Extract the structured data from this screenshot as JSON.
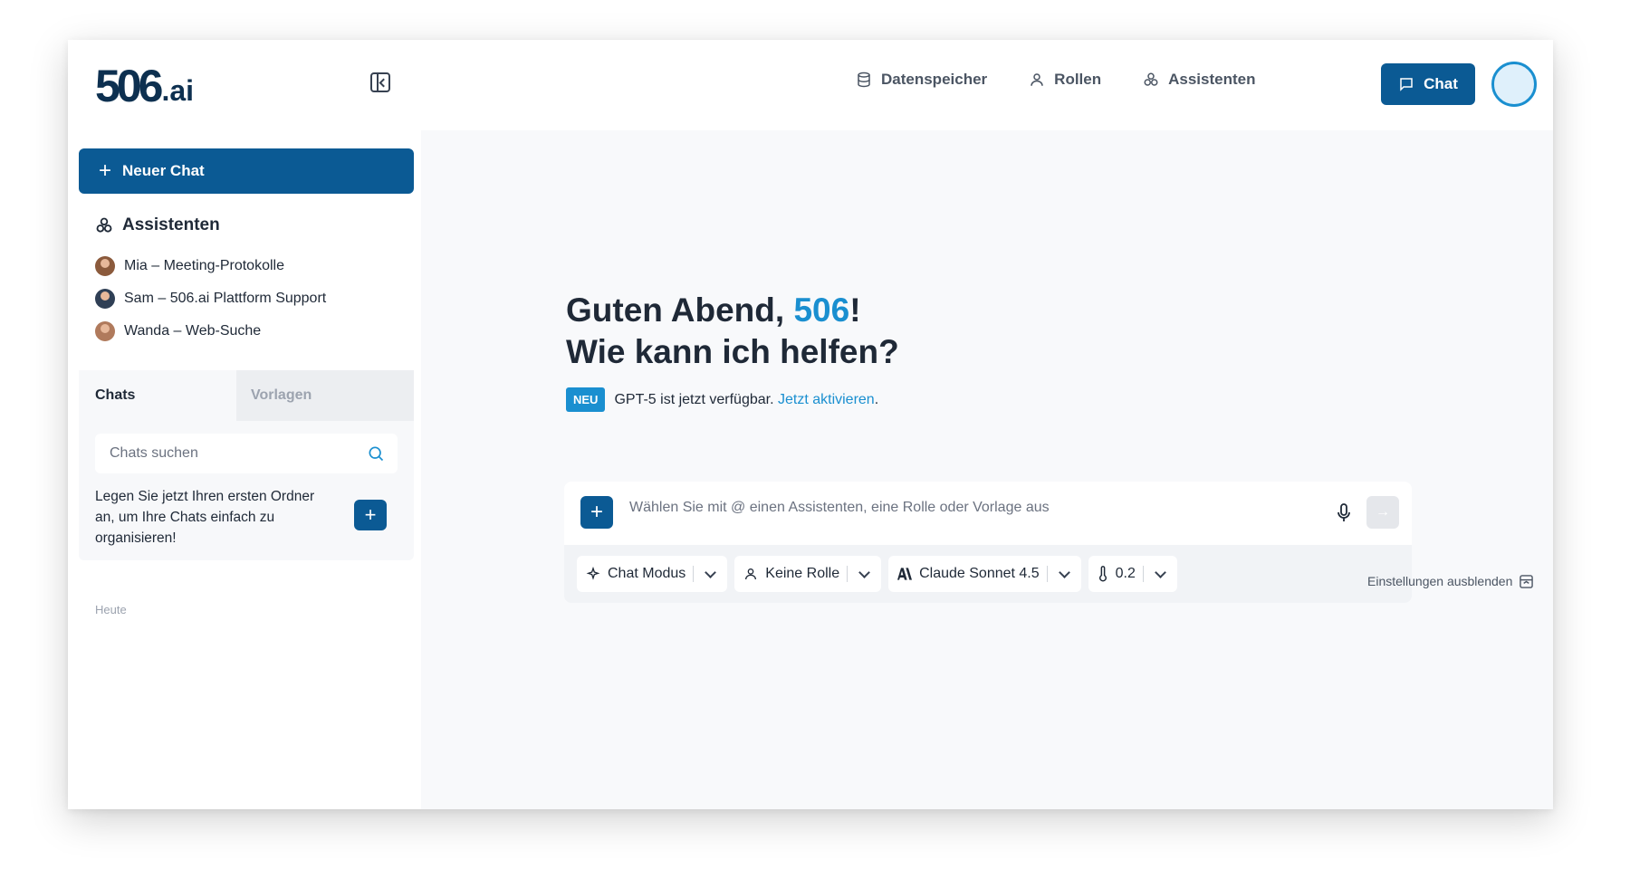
{
  "brand": {
    "logo_main": "506",
    "logo_suffix": ".ai"
  },
  "topnav": {
    "items": [
      {
        "label": "Datenspeicher",
        "icon": "database-icon"
      },
      {
        "label": "Rollen",
        "icon": "user-icon"
      },
      {
        "label": "Assistenten",
        "icon": "assistants-icon"
      }
    ],
    "chat_button": "Chat"
  },
  "sidebar": {
    "new_chat": "Neuer Chat",
    "assistants_heading": "Assistenten",
    "assistants": [
      {
        "label": "Mia – Meeting-Protokolle"
      },
      {
        "label": "Sam – 506.ai Plattform Support"
      },
      {
        "label": "Wanda – Web-Suche"
      }
    ],
    "tabs": [
      {
        "label": "Chats",
        "active": true
      },
      {
        "label": "Vorlagen",
        "active": false
      }
    ],
    "search_placeholder": "Chats suchen",
    "folder_hint": "Legen Sie jetzt Ihren ersten Ordner an, um Ihre Chats einfach zu organisieren!",
    "group_today": "Heute"
  },
  "main": {
    "greeting_prefix": "Guten Abend, ",
    "greeting_name": "506",
    "greeting_suffix": "!",
    "greeting_line2": "Wie kann ich helfen?",
    "badge": "NEU",
    "announcement": "GPT-5 ist jetzt verfügbar.",
    "announcement_link": "Jetzt aktivieren",
    "announcement_end": ".",
    "composer_placeholder": "Wählen Sie mit @ einen Assistenten, eine Rolle oder Vorlage aus",
    "chips": [
      {
        "label": "Chat Modus",
        "icon": "sparkle-icon"
      },
      {
        "label": "Keine Rolle",
        "icon": "user-icon"
      },
      {
        "label": "Claude Sonnet 4.5",
        "icon": "anthropic-icon"
      },
      {
        "label": "0.2",
        "icon": "thermometer-icon"
      }
    ],
    "hide_settings": "Einstellungen ausblenden"
  },
  "colors": {
    "primary": "#0b5a94",
    "accent": "#1a8fd0"
  }
}
